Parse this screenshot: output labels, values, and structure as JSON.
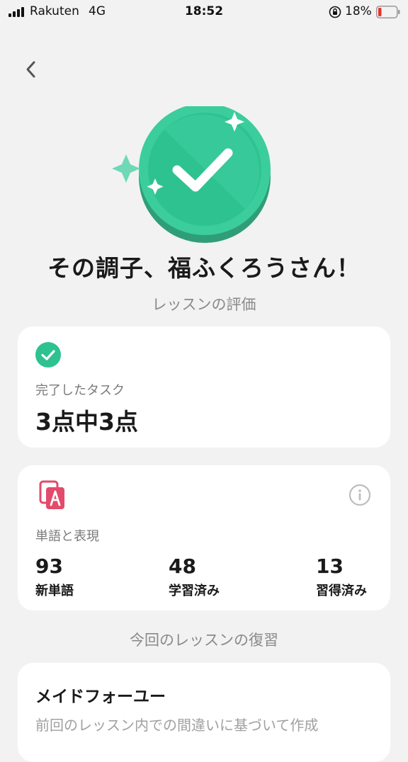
{
  "status_bar": {
    "carrier": "Rakuten",
    "network": "4G",
    "time": "18:52",
    "battery_percent": "18%",
    "battery_level": 0.18,
    "signal_icon": "signal-bars-icon",
    "orientation_lock_icon": "orientation-lock-icon",
    "battery_icon": "battery-low-icon"
  },
  "header": {
    "back_icon": "chevron-left-icon"
  },
  "hero": {
    "icon": "checkmark-coin-icon",
    "headline": "その調子、福ふくろうさん！",
    "subhead": "レッスンの評価"
  },
  "tasks_card": {
    "icon": "check-circle-icon",
    "label": "完了したタスク",
    "value": "3点中3点"
  },
  "vocab_card": {
    "icon": "vocabulary-cards-icon",
    "info_icon": "info-icon",
    "label": "単語と表現",
    "stats": [
      {
        "value": "93",
        "label": "新単語"
      },
      {
        "value": "48",
        "label": "学習済み"
      },
      {
        "value": "13",
        "label": "習得済み"
      }
    ]
  },
  "review": {
    "heading": "今回のレッスンの復習",
    "card_title": "メイドフォーユー",
    "card_desc": "前回のレッスン内での間違いに基づいて作成"
  },
  "colors": {
    "accent_green": "#2dc28f",
    "vocab_pink": "#e24b6b",
    "battery_red": "#e5342f",
    "background": "#f2f2f2"
  }
}
